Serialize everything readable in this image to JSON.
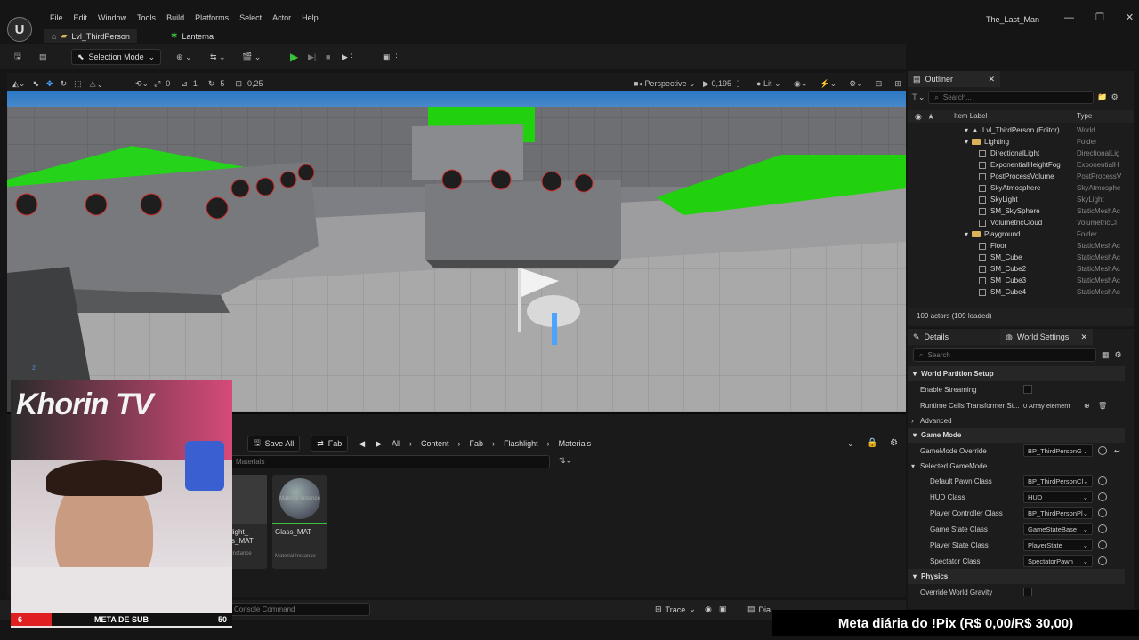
{
  "menu": [
    "File",
    "Edit",
    "Window",
    "Tools",
    "Build",
    "Platforms",
    "Select",
    "Actor",
    "Help"
  ],
  "project_name": "The_Last_Man",
  "tabs": [
    {
      "label": "Lvl_ThirdPerson"
    },
    {
      "label": "Lanterna"
    }
  ],
  "toolbar": {
    "selection_mode": "Selection Mode"
  },
  "viewport_toolbar": {
    "angle": "0",
    "scale": "1",
    "rotation": "5",
    "snap": "0,25",
    "view_mode": "Perspective",
    "speed": "0,195",
    "lit": "Lit"
  },
  "outliner": {
    "title": "Outliner",
    "search_placeholder": "Search...",
    "col_label": "Item Label",
    "col_type": "Type",
    "items": [
      {
        "label": "Lvl_ThirdPerson (Editor)",
        "type": "World"
      },
      {
        "label": "Lighting",
        "type": "Folder"
      },
      {
        "label": "DirectionalLight",
        "type": "DirectionalLig"
      },
      {
        "label": "ExponentialHeightFog",
        "type": "ExponentialH"
      },
      {
        "label": "PostProcessVolume",
        "type": "PostProcessV"
      },
      {
        "label": "SkyAtmosphere",
        "type": "SkyAtmosphe"
      },
      {
        "label": "SkyLight",
        "type": "SkyLight"
      },
      {
        "label": "SM_SkySphere",
        "type": "StaticMeshAc"
      },
      {
        "label": "VolumetricCloud",
        "type": "VolumetricCl"
      },
      {
        "label": "Playground",
        "type": "Folder"
      },
      {
        "label": "Floor",
        "type": "StaticMeshAc"
      },
      {
        "label": "SM_Cube",
        "type": "StaticMeshAc"
      },
      {
        "label": "SM_Cube2",
        "type": "StaticMeshAc"
      },
      {
        "label": "SM_Cube3",
        "type": "StaticMeshAc"
      },
      {
        "label": "SM_Cube4",
        "type": "StaticMeshAc"
      }
    ],
    "footer": "109 actors (109 loaded)"
  },
  "details": {
    "tab1": "Details",
    "tab2": "World Settings",
    "search_placeholder": "Search",
    "sections": {
      "world_partition": "World Partition Setup",
      "enable_streaming": "Enable Streaming",
      "runtime_cells": "Runtime Cells Transformer St...",
      "runtime_cells_value": "0 Array element",
      "advanced": "Advanced",
      "game_mode": "Game Mode",
      "game_mode_override": "GameMode Override",
      "game_mode_override_value": "BP_ThirdPersonG",
      "selected_game_mode": "Selected GameMode",
      "physics": "Physics",
      "override_gravity": "Override World Gravity"
    },
    "props": [
      {
        "label": "Default Pawn Class",
        "value": "BP_ThirdPersonCl"
      },
      {
        "label": "HUD Class",
        "value": "HUD"
      },
      {
        "label": "Player Controller Class",
        "value": "BP_ThirdPersonPl"
      },
      {
        "label": "Game State Class",
        "value": "GameStateBase"
      },
      {
        "label": "Player State Class",
        "value": "PlayerState"
      },
      {
        "label": "Spectator Class",
        "value": "SpectatorPawn"
      }
    ]
  },
  "content_browser": {
    "save_all": "Save All",
    "fab": "Fab",
    "breadcrumb": [
      "All",
      "Content",
      "Fab",
      "Flashlight",
      "Materials"
    ],
    "search_text": "Materials",
    "assets": [
      {
        "name": "light_ s_MAT",
        "type": "Instance"
      },
      {
        "name": "Glass_MAT",
        "type": "Material Instance",
        "thumb": "Material Instance"
      }
    ]
  },
  "status": {
    "console": "Console Command",
    "trace": "Trace",
    "dia": "Dia"
  },
  "overlay": {
    "pix_goal": "Meta diária do !Pix (R$ 0,00/R$ 30,00)",
    "sub_goal": "META DE SUB",
    "sub_current": "6",
    "sub_target": "50",
    "webcam_logo": "Khorin TV"
  },
  "colors": {
    "accent_green": "#22d10e",
    "play_green": "#3ac23a",
    "folder": "#d9b25a"
  }
}
